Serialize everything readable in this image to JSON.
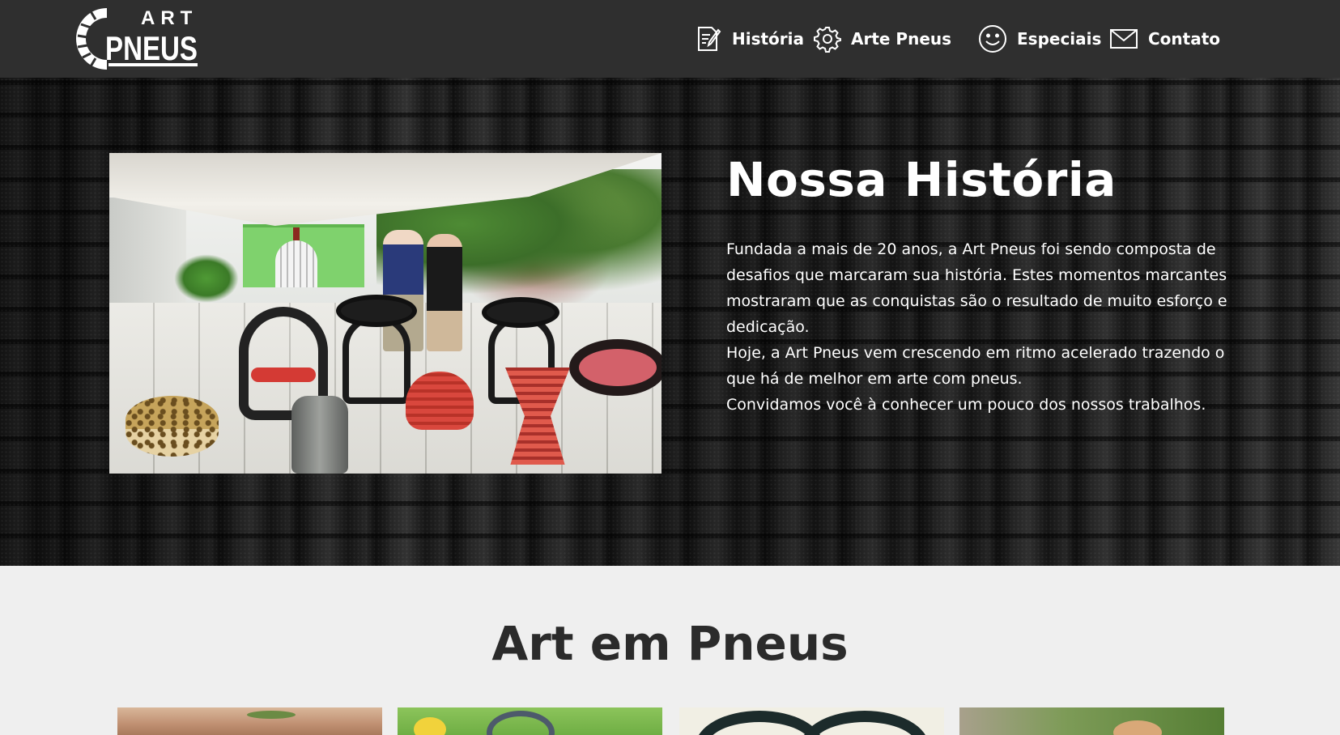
{
  "nav": {
    "logo": {
      "line1": "ART",
      "line2": "PNEUS"
    },
    "items": [
      {
        "label": "História",
        "icon": "edit-document-icon"
      },
      {
        "label": "Arte Pneus",
        "icon": "gear-icon"
      },
      {
        "label": "Especiais",
        "icon": "smiley-icon"
      },
      {
        "label": "Contato",
        "icon": "envelope-icon"
      }
    ]
  },
  "hero": {
    "title": "Nossa História",
    "paragraphs": [
      "Fundada a mais de 20 anos, a Art Pneus foi sendo composta de desafios que marcaram sua história. Estes momentos marcantes mostraram que as conquistas são o resultado de muito esforço e dedicação.",
      "Hoje, a Art Pneus vem crescendo em ritmo acelerado trazendo o que há de melhor em arte com pneus.",
      "Convidamos você à conhecer um pouco dos nossos trabalhos."
    ]
  },
  "section2": {
    "title": "Art em Pneus"
  },
  "colors": {
    "nav_bg": "#2f2f2f",
    "section_bg": "#efefef",
    "heading_dark": "#2b2b2b",
    "text_light": "#ffffff"
  }
}
